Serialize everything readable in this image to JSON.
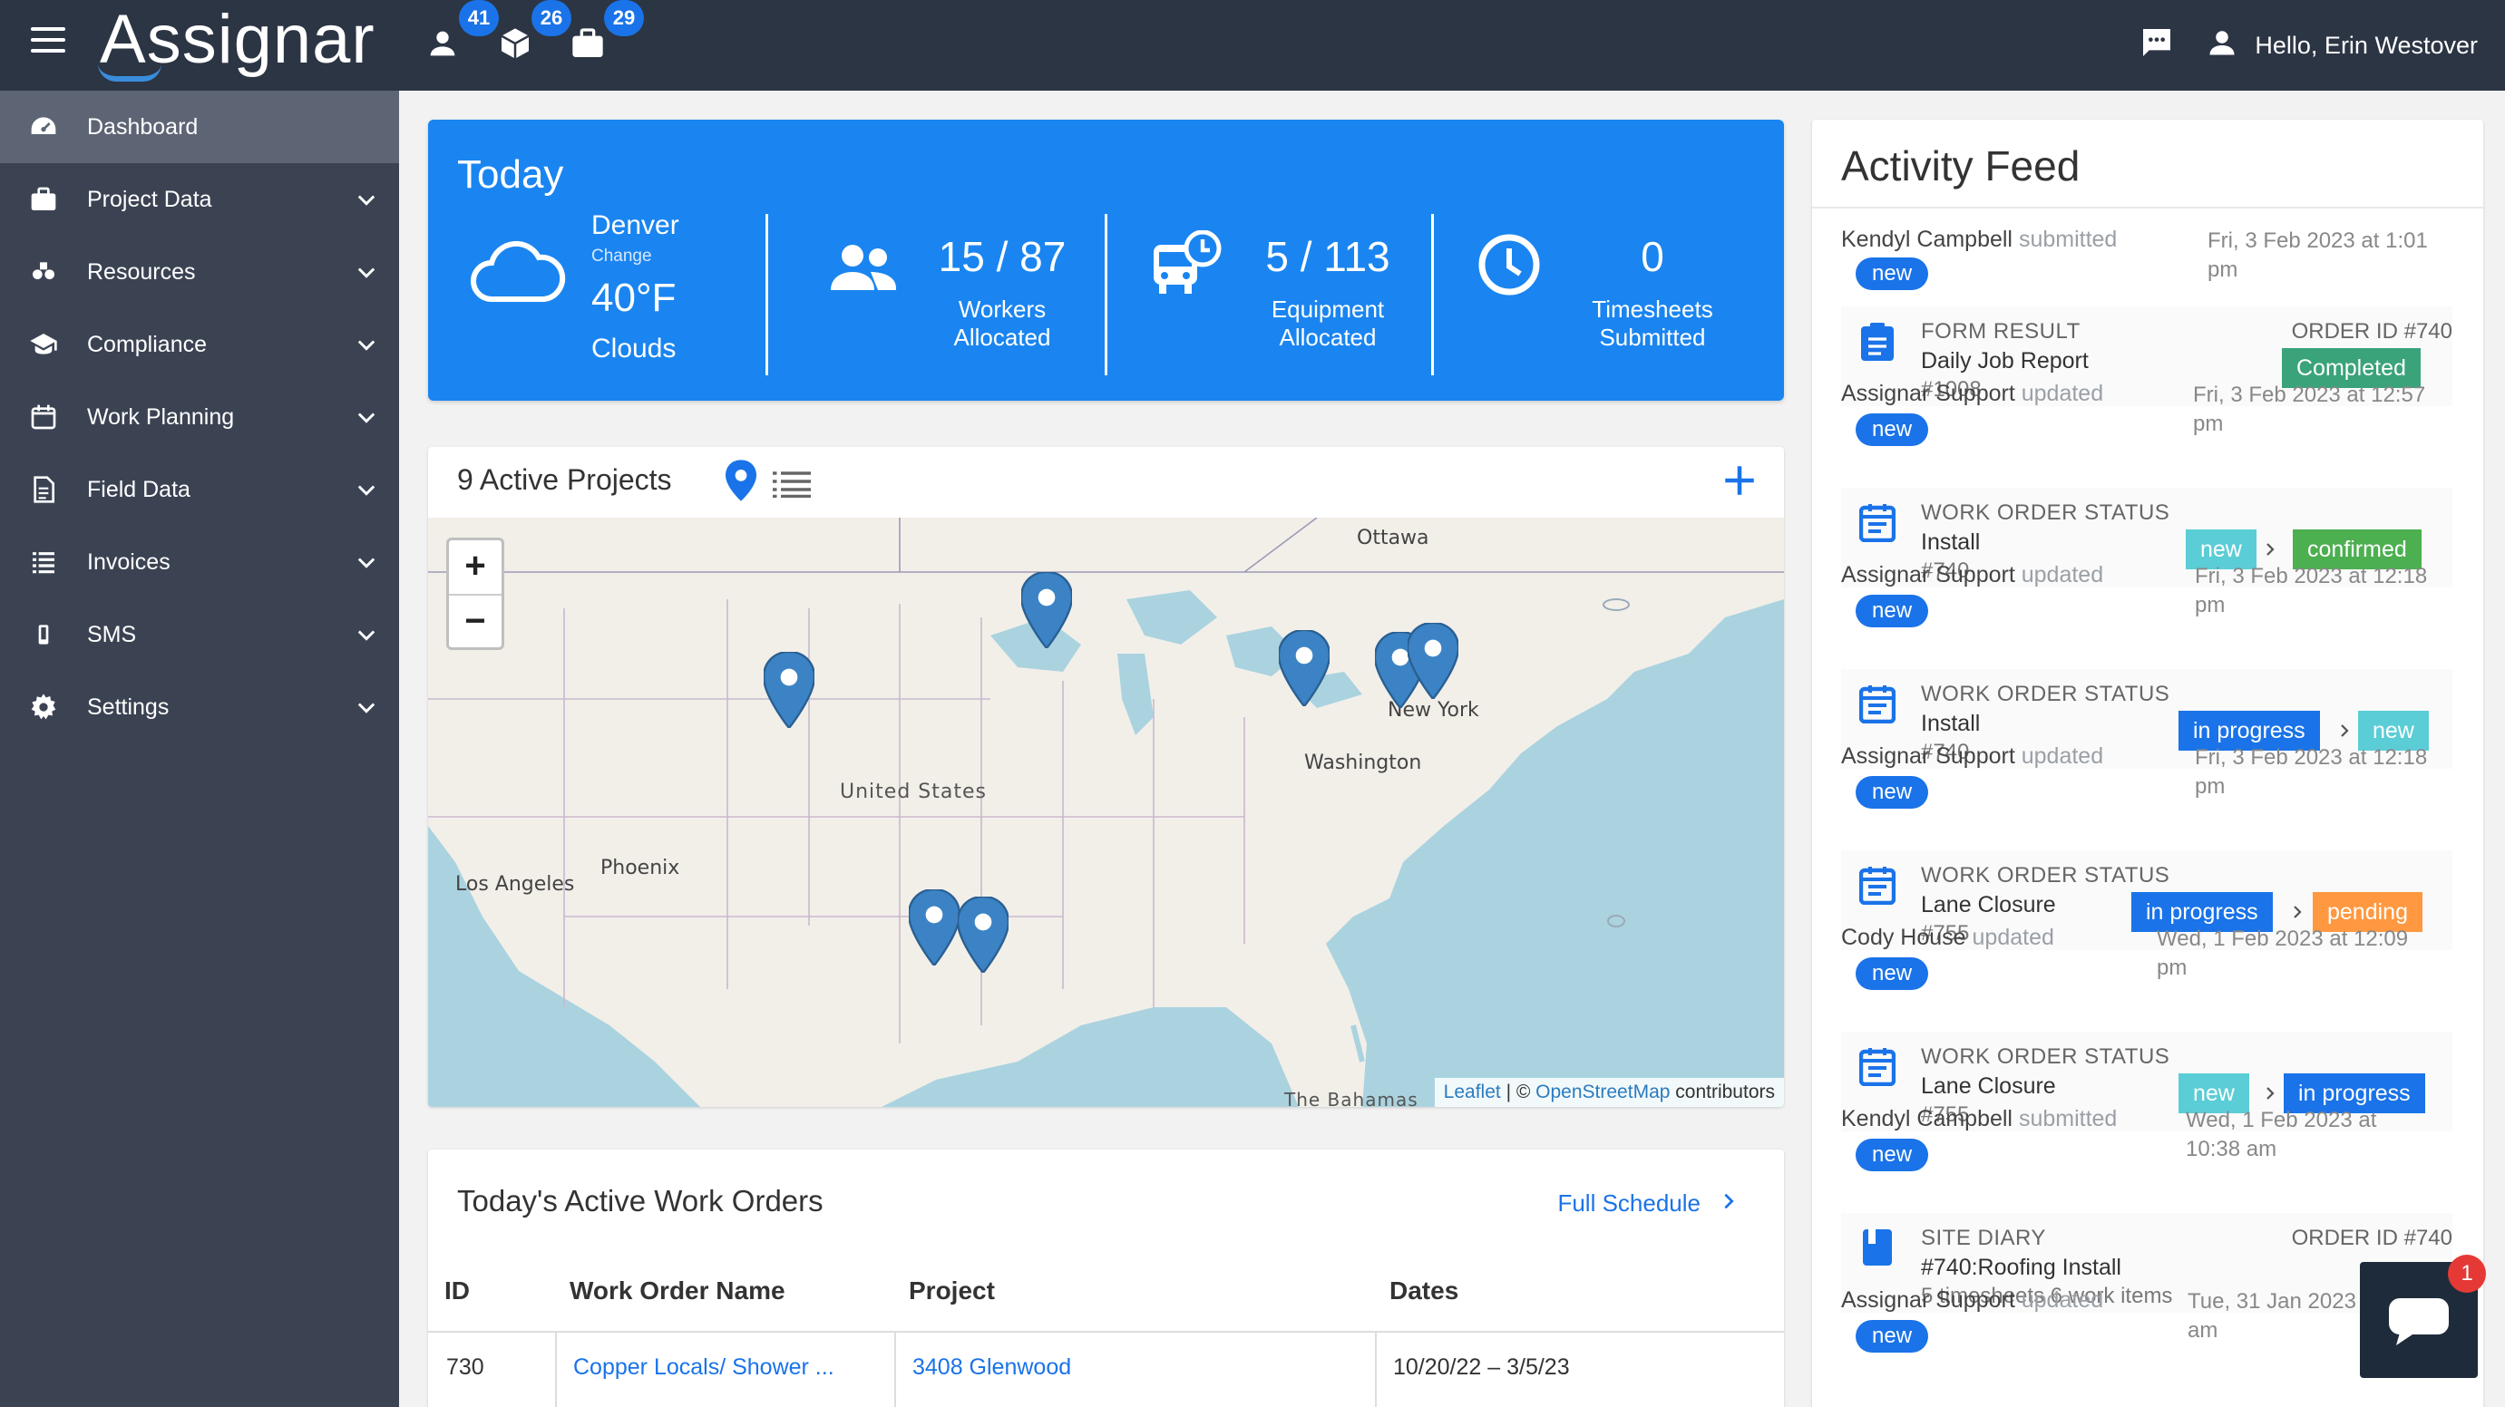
{
  "header": {
    "logo": "Assignar",
    "badges": {
      "workers": "41",
      "equipment": "26",
      "projects": "29"
    },
    "greeting": "Hello, Erin Westover"
  },
  "sidebar": {
    "items": [
      {
        "label": "Dashboard",
        "icon": "dashboard-icon",
        "active": true
      },
      {
        "label": "Project Data",
        "icon": "briefcase-icon"
      },
      {
        "label": "Resources",
        "icon": "resources-icon"
      },
      {
        "label": "Compliance",
        "icon": "graduation-cap-icon"
      },
      {
        "label": "Work Planning",
        "icon": "calendar-icon"
      },
      {
        "label": "Field Data",
        "icon": "document-icon"
      },
      {
        "label": "Invoices",
        "icon": "list-icon"
      },
      {
        "label": "SMS",
        "icon": "phone-icon"
      },
      {
        "label": "Settings",
        "icon": "gear-icon"
      }
    ]
  },
  "today": {
    "title": "Today",
    "weather": {
      "city": "Denver",
      "change": "Change",
      "temp": "40°F",
      "condition": "Clouds"
    },
    "workers": {
      "value": "15 / 87",
      "label1": "Workers",
      "label2": "Allocated"
    },
    "equipment": {
      "value": "5 / 113",
      "label1": "Equipment",
      "label2": "Allocated"
    },
    "timesheets": {
      "value": "0",
      "label1": "Timesheets",
      "label2": "Submitted"
    }
  },
  "projects": {
    "title": "9 Active Projects",
    "map": {
      "cities": [
        "Ottawa",
        "New York",
        "Washington",
        "Phoenix",
        "Los Angeles"
      ],
      "country": "United States",
      "region": "The Bahamas",
      "attribution": {
        "leaflet": "Leaflet",
        "sep": " | © ",
        "osm": "OpenStreetMap",
        "rest": " contributors"
      }
    }
  },
  "workorders": {
    "title": "Today's Active Work Orders",
    "full_schedule": "Full Schedule",
    "columns": [
      "ID",
      "Work Order Name",
      "Project",
      "Dates"
    ],
    "rows": [
      {
        "id": "730",
        "name": "Copper Locals/ Shower ...",
        "project": "3408 Glenwood",
        "dates": "10/20/22 – 3/5/23"
      }
    ]
  },
  "feed": {
    "title": "Activity Feed",
    "entries": [
      {
        "who": "Kendyl Campbell",
        "action": "submitted",
        "time1": "Fri, 3 Feb 2023 at 1:01",
        "time2": "pm",
        "pill": "new"
      },
      {
        "category": "FORM RESULT",
        "name": "Daily Job Report",
        "num": "#1008",
        "order": "ORDER ID #740",
        "status": "Completed",
        "who": "Assignar Support",
        "action": "updated",
        "time1": "Fri, 3 Feb 2023 at 12:57",
        "time2": "pm",
        "pill": "new"
      },
      {
        "category": "WORK ORDER STATUS",
        "name": "Install",
        "num": "#740",
        "from": "new",
        "to": "confirmed",
        "who": "Assignar Support",
        "action": "updated",
        "time1": "Fri, 3 Feb 2023 at 12:18",
        "time2": "pm",
        "pill": "new"
      },
      {
        "category": "WORK ORDER STATUS",
        "name": "Install",
        "num": "#740",
        "from": "in progress",
        "to": "new",
        "who": "Assignar Support",
        "action": "updated",
        "time1": "Fri, 3 Feb 2023 at 12:18",
        "time2": "pm",
        "pill": "new"
      },
      {
        "category": "WORK ORDER STATUS",
        "name": "Lane Closure",
        "num": "#755",
        "from": "in progress",
        "to": "pending",
        "who": "Cody House",
        "action": "updated",
        "time1": "Wed, 1 Feb 2023 at 12:09",
        "time2": "pm",
        "pill": "new"
      },
      {
        "category": "WORK ORDER STATUS",
        "name": "Lane Closure",
        "num": "#755",
        "from": "new",
        "to": "in progress",
        "who": "Kendyl Campbell",
        "action": "submitted",
        "time1": "Wed, 1 Feb 2023 at",
        "time2": "10:38 am",
        "pill": "new"
      },
      {
        "category": "SITE DIARY",
        "name": "#740:Roofing Install",
        "num": "5 timesheets 6 work items",
        "order": "ORDER ID #740",
        "who": "Assignar Support",
        "action": "updated",
        "time1": "Tue, 31 Jan 2023",
        "time2": "am",
        "pill": "new"
      }
    ]
  },
  "chat": {
    "badge": "1"
  },
  "colors": {
    "topbar": "#2c3544",
    "sidebar": "#3b4353",
    "accent": "#1a85f0",
    "link": "#1a73e8"
  }
}
